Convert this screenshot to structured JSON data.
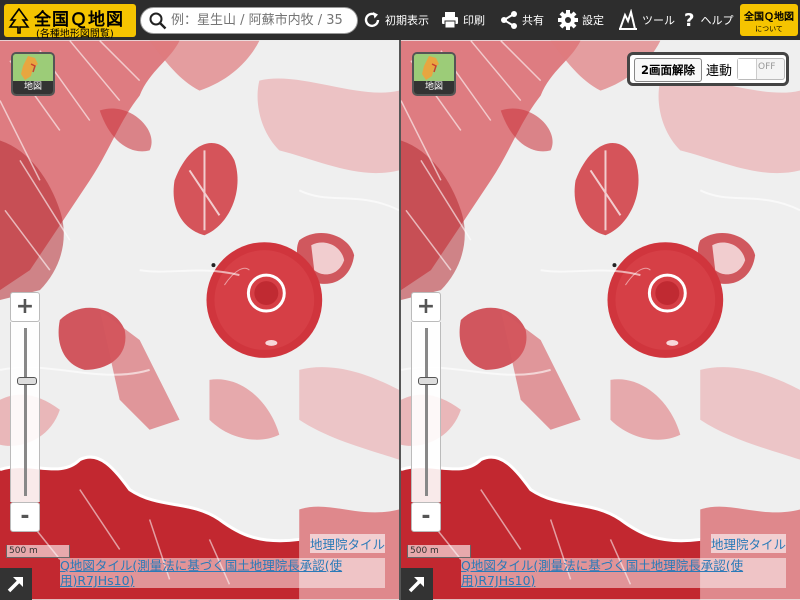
{
  "header": {
    "logo_title": "全国Ｑ地図",
    "logo_subtitle": "(各種地形図閲覧)",
    "search_placeholder": "例：星生山 / 阿蘇市内牧 / 35",
    "reset_label": "初期表示",
    "print_label": "印刷",
    "share_label": "共有",
    "settings_label": "設定",
    "tools_label": "ツール",
    "help_label": "ヘルプ",
    "about_line1": "全国Ｑ地図",
    "about_line2": "について"
  },
  "left_map": {
    "layer_button_label": "地図",
    "zoom_in": "+",
    "zoom_out": "-",
    "scale_label": "500 m",
    "tile_attribution": "地理院タイル",
    "gsi_attribution": "Q地図タイル(測量法に基づく国土地理院長承認(使用)R7JHs10)"
  },
  "right_map": {
    "layer_button_label": "地図",
    "zoom_in": "+",
    "zoom_out": "-",
    "scale_label": "500 m",
    "tile_attribution": "地理院タイル",
    "gsi_attribution": "Q地図タイル(測量法に基づく国土地理院長承認(使用)R7JHs10)",
    "split_cancel_label": "2画面解除",
    "sync_label": "連動",
    "sync_state": "OFF"
  },
  "colors": {
    "toolbar_bg": "#2d2d2d",
    "accent_yellow": "#f5c400",
    "relief_red": "#c8202a",
    "link_blue": "#2a7ab8"
  },
  "icons": [
    "tree-icon",
    "search-icon",
    "reset-icon",
    "print-icon",
    "share-icon",
    "gear-icon",
    "tools-icon",
    "help-icon",
    "expand-icon"
  ]
}
